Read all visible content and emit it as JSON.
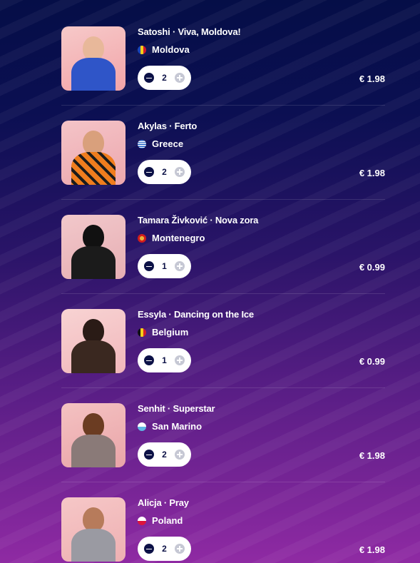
{
  "cart": {
    "items": [
      {
        "title": "Satoshi · Viva, Moldova!",
        "country": "Moldova",
        "qty": "2",
        "price": "€ 1.98"
      },
      {
        "title": "Akylas · Ferto",
        "country": "Greece",
        "qty": "2",
        "price": "€ 1.98"
      },
      {
        "title": "Tamara Živković · Nova zora",
        "country": "Montenegro",
        "qty": "1",
        "price": "€ 0.99"
      },
      {
        "title": "Essyla · Dancing on the Ice",
        "country": "Belgium",
        "qty": "1",
        "price": "€ 0.99"
      },
      {
        "title": "Senhit · Superstar",
        "country": "San Marino",
        "qty": "2",
        "price": "€ 1.98"
      },
      {
        "title": "Alicja · Pray",
        "country": "Poland",
        "qty": "2",
        "price": "€ 1.98"
      }
    ]
  },
  "theme": {
    "background_top": "#050e47",
    "background_bottom": "#8f2aa3",
    "stepper_minus": "#0c1146",
    "stepper_plus_disabled": "#c6c8d4"
  },
  "icons": {
    "decrease": "minus-circle-icon",
    "increase": "plus-circle-icon"
  }
}
